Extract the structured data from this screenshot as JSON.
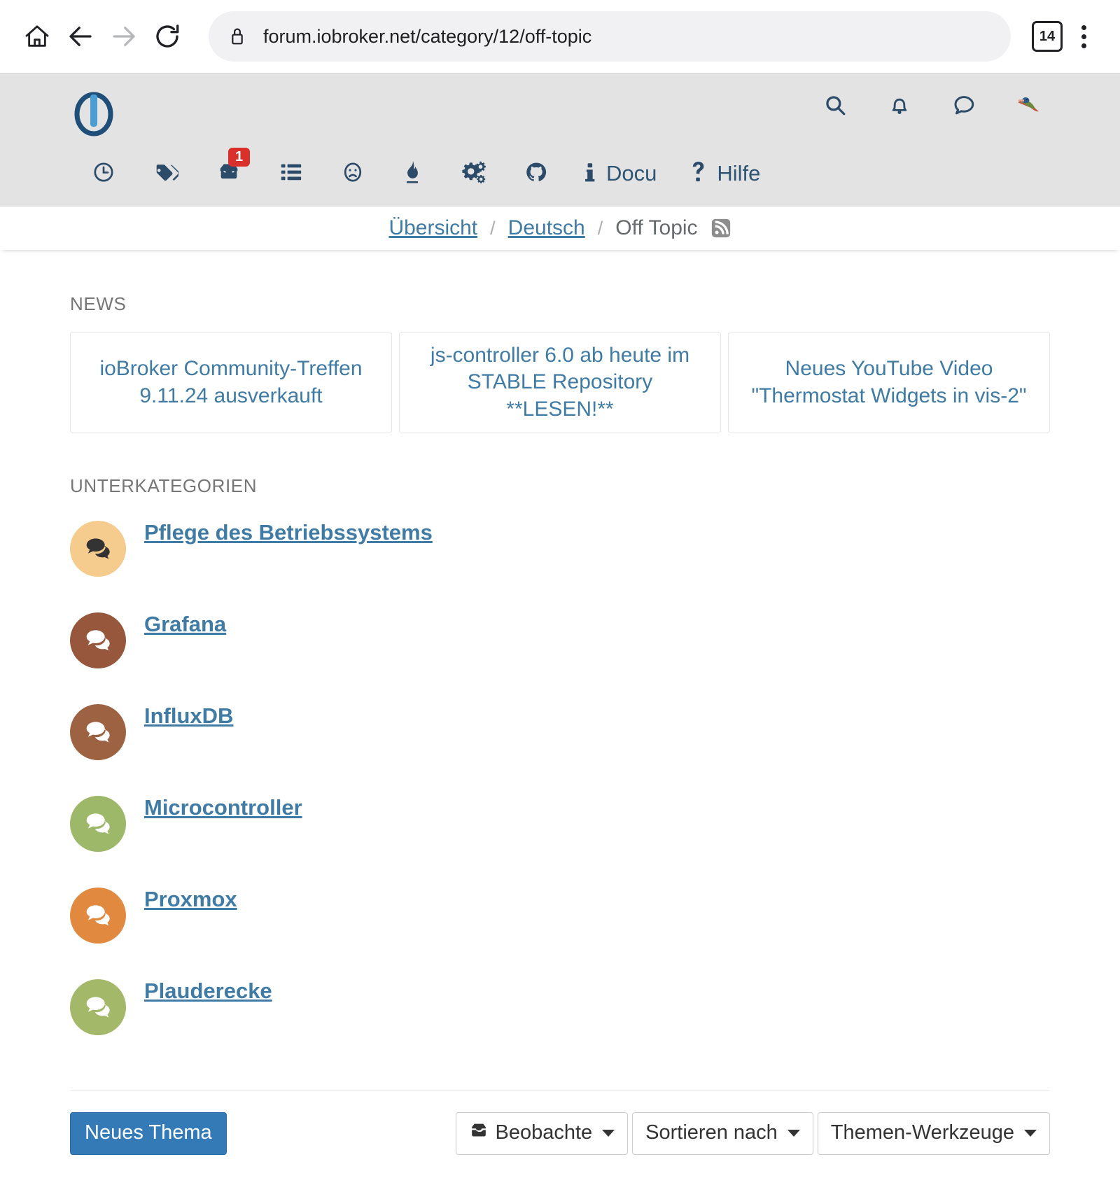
{
  "browser": {
    "home_icon": "home-icon",
    "back_icon": "back-arrow-icon",
    "forward_icon": "forward-arrow-icon",
    "reload_icon": "reload-icon",
    "lock_icon": "lock-icon",
    "url": "forum.iobroker.net/category/12/off-topic",
    "url_placeholder": "Search or type URL",
    "tab_count": "14",
    "menu_icon": "kebab-menu-icon"
  },
  "forum_header": {
    "logo_name": "iobroker-logo",
    "icons": [
      {
        "name": "search-icon"
      },
      {
        "name": "bell-icon"
      },
      {
        "name": "chat-bubble-icon"
      },
      {
        "name": "user-avatar"
      }
    ],
    "nav": [
      {
        "name": "recent-icon",
        "label": "",
        "badge": ""
      },
      {
        "name": "tags-icon",
        "label": "",
        "badge": ""
      },
      {
        "name": "inbox-icon",
        "label": "",
        "badge": "1"
      },
      {
        "name": "categories-list-icon",
        "label": "",
        "badge": ""
      },
      {
        "name": "unsolved-sad-face-icon",
        "label": "",
        "badge": ""
      },
      {
        "name": "flame-popular-icon",
        "label": "",
        "badge": ""
      },
      {
        "name": "gears-adapter-icon",
        "label": "",
        "badge": ""
      },
      {
        "name": "github-icon",
        "label": "",
        "badge": ""
      },
      {
        "name": "info-icon",
        "label": "Docu",
        "badge": ""
      },
      {
        "name": "question-mark-icon",
        "label": "Hilfe",
        "badge": ""
      }
    ]
  },
  "breadcrumb": {
    "items": [
      {
        "label": "Übersicht",
        "current": false
      },
      {
        "label": "Deutsch",
        "current": false
      },
      {
        "label": "Off Topic",
        "current": true
      }
    ],
    "separator": "/",
    "rss_icon": "rss-feed-icon"
  },
  "news": {
    "heading": "NEWS",
    "cards": [
      {
        "title": "ioBroker Community-Treffen 9.11.24 ausverkauft"
      },
      {
        "title": "js-controller 6.0 ab heute im STABLE Repository **LESEN!**"
      },
      {
        "title": "Neues YouTube Video \"Thermostat Widgets in vis-2\""
      }
    ]
  },
  "subcategories": {
    "heading": "UNTERKATEGORIEN",
    "items": [
      {
        "name": "Pflege des Betriebssystems",
        "bg": "#f6cb8e",
        "fg": "#333333"
      },
      {
        "name": "Grafana",
        "bg": "#96573c",
        "fg": "#ffffff"
      },
      {
        "name": "InfluxDB",
        "bg": "#9d6242",
        "fg": "#ffffff"
      },
      {
        "name": "Microcontroller",
        "bg": "#9cb868",
        "fg": "#ffffff"
      },
      {
        "name": "Proxmox",
        "bg": "#e0893f",
        "fg": "#ffffff"
      },
      {
        "name": "Plauderecke",
        "bg": "#a3b868",
        "fg": "#ffffff"
      }
    ]
  },
  "footer": {
    "new_topic_label": "Neues Thema",
    "watch_label": "Beobachte",
    "watch_icon": "inbox-icon",
    "sort_label": "Sortieren nach",
    "tools_label": "Themen-Werkzeuge"
  },
  "colors": {
    "accent": "#3f7ba5",
    "primary_button": "#337ab7",
    "badge_red": "#d9302c",
    "header_bg": "#e3e3e3",
    "nav_icon": "#2c4b69"
  }
}
